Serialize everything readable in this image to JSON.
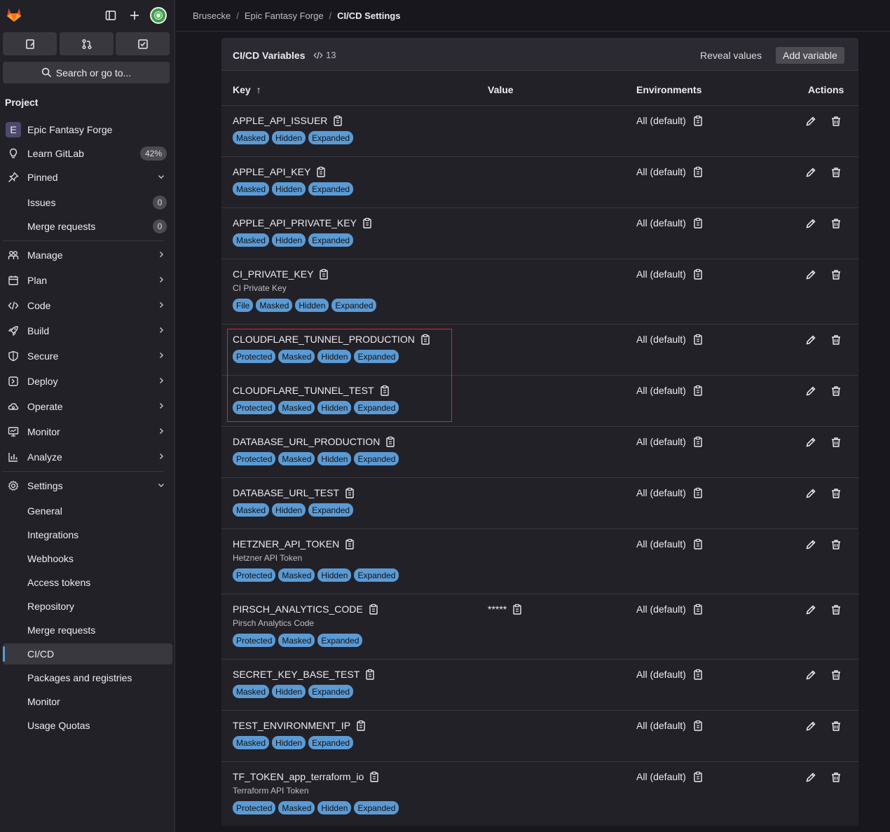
{
  "sidebar": {
    "search_label": "Search or go to...",
    "section_title": "Project",
    "project": {
      "letter": "E",
      "name": "Epic Fantasy Forge"
    },
    "learn": {
      "label": "Learn GitLab",
      "progress": "42%"
    },
    "pinned": {
      "label": "Pinned",
      "items": [
        {
          "label": "Issues",
          "count": "0"
        },
        {
          "label": "Merge requests",
          "count": "0"
        }
      ]
    },
    "nav": [
      {
        "label": "Manage",
        "icon": "users-icon"
      },
      {
        "label": "Plan",
        "icon": "calendar-icon"
      },
      {
        "label": "Code",
        "icon": "code-icon"
      },
      {
        "label": "Build",
        "icon": "rocket-icon"
      },
      {
        "label": "Secure",
        "icon": "shield-icon"
      },
      {
        "label": "Deploy",
        "icon": "deploy-icon"
      },
      {
        "label": "Operate",
        "icon": "cloud-gear-icon"
      },
      {
        "label": "Monitor",
        "icon": "monitor-icon"
      },
      {
        "label": "Analyze",
        "icon": "chart-icon"
      }
    ],
    "settings": {
      "label": "Settings",
      "items": [
        "General",
        "Integrations",
        "Webhooks",
        "Access tokens",
        "Repository",
        "Merge requests",
        "CI/CD",
        "Packages and registries",
        "Monitor",
        "Usage Quotas"
      ],
      "active": "CI/CD"
    }
  },
  "breadcrumb": [
    "Brusecke",
    "Epic Fantasy Forge",
    "CI/CD Settings"
  ],
  "card": {
    "title": "CI/CD Variables",
    "count": "13",
    "reveal_label": "Reveal values",
    "add_label": "Add variable",
    "columns": {
      "key": "Key",
      "sort_indicator": "↑",
      "value": "Value",
      "environments": "Environments",
      "actions": "Actions"
    }
  },
  "variables": [
    {
      "key": "APPLE_API_ISSUER",
      "description": "",
      "value": "",
      "env": "All (default)",
      "badges": [
        "Masked",
        "Hidden",
        "Expanded"
      ]
    },
    {
      "key": "APPLE_API_KEY",
      "description": "",
      "value": "",
      "env": "All (default)",
      "badges": [
        "Masked",
        "Hidden",
        "Expanded"
      ]
    },
    {
      "key": "APPLE_API_PRIVATE_KEY",
      "description": "",
      "value": "",
      "env": "All (default)",
      "badges": [
        "Masked",
        "Hidden",
        "Expanded"
      ]
    },
    {
      "key": "CI_PRIVATE_KEY",
      "description": "CI Private Key",
      "value": "",
      "env": "All (default)",
      "badges": [
        "File",
        "Masked",
        "Hidden",
        "Expanded"
      ]
    },
    {
      "key": "CLOUDFLARE_TUNNEL_PRODUCTION",
      "description": "",
      "value": "",
      "env": "All (default)",
      "badges": [
        "Protected",
        "Masked",
        "Hidden",
        "Expanded"
      ]
    },
    {
      "key": "CLOUDFLARE_TUNNEL_TEST",
      "description": "",
      "value": "",
      "env": "All (default)",
      "badges": [
        "Protected",
        "Masked",
        "Hidden",
        "Expanded"
      ]
    },
    {
      "key": "DATABASE_URL_PRODUCTION",
      "description": "",
      "value": "",
      "env": "All (default)",
      "badges": [
        "Protected",
        "Masked",
        "Hidden",
        "Expanded"
      ]
    },
    {
      "key": "DATABASE_URL_TEST",
      "description": "",
      "value": "",
      "env": "All (default)",
      "badges": [
        "Masked",
        "Hidden",
        "Expanded"
      ]
    },
    {
      "key": "HETZNER_API_TOKEN",
      "description": "Hetzner API Token",
      "value": "",
      "env": "All (default)",
      "badges": [
        "Protected",
        "Masked",
        "Hidden",
        "Expanded"
      ]
    },
    {
      "key": "PIRSCH_ANALYTICS_CODE",
      "description": "Pirsch Analytics Code",
      "value": "*****",
      "env": "All (default)",
      "badges": [
        "Protected",
        "Masked",
        "Expanded"
      ]
    },
    {
      "key": "SECRET_KEY_BASE_TEST",
      "description": "",
      "value": "",
      "env": "All (default)",
      "badges": [
        "Masked",
        "Hidden",
        "Expanded"
      ]
    },
    {
      "key": "TEST_ENVIRONMENT_IP",
      "description": "",
      "value": "",
      "env": "All (default)",
      "badges": [
        "Masked",
        "Hidden",
        "Expanded"
      ]
    },
    {
      "key": "TF_TOKEN_app_terraform_io",
      "description": "Terraform API Token",
      "value": "",
      "env": "All (default)",
      "badges": [
        "Protected",
        "Masked",
        "Hidden",
        "Expanded"
      ]
    }
  ],
  "colors": {
    "badge": "#5b9bd5",
    "highlight": "#e02424",
    "gitlab_orange": "#e24329"
  }
}
